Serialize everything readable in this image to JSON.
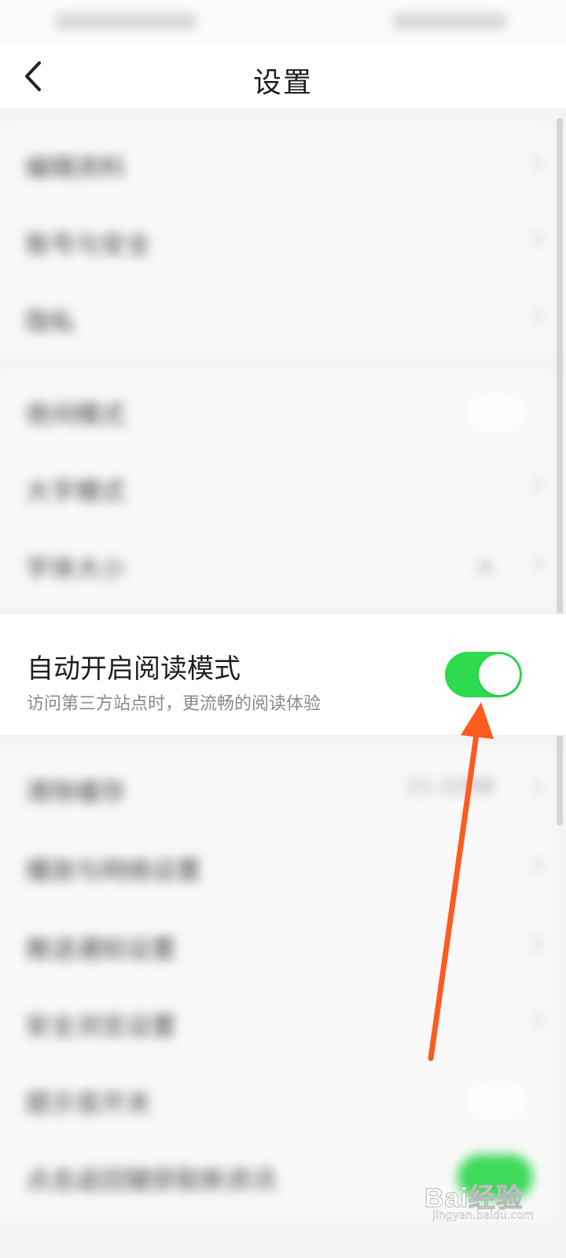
{
  "status_bar": {
    "left_text": "",
    "right_text": ""
  },
  "header": {
    "title": "设置"
  },
  "sections": [
    {
      "items": [
        {
          "label": "编辑资料"
        },
        {
          "label": "账号与安全"
        },
        {
          "label": "隐私"
        }
      ]
    },
    {
      "items": [
        {
          "label": "夜间模式",
          "toggle": "off"
        },
        {
          "label": "大字模式"
        },
        {
          "label": "字体大小",
          "value": "大"
        }
      ]
    },
    {
      "items": [
        {
          "label": "清除缓存",
          "value": "15.32MB"
        },
        {
          "label": "播放与网络设置"
        },
        {
          "label": "推送通知设置"
        },
        {
          "label": "安全浏览设置"
        },
        {
          "label": "提示音开关",
          "toggle": "off"
        },
        {
          "label": "点击返回键获取新资讯",
          "toggle": "on"
        }
      ]
    }
  ],
  "reader_mode": {
    "title": "自动开启阅读模式",
    "subtitle": "访问第三方站点时，更流畅的阅读体验",
    "toggle_state": "on",
    "toggle_color": "#2edb4f"
  },
  "annotation": {
    "arrow_color": "#ff5a1f"
  },
  "watermark": {
    "logo_text": "Bai经验",
    "url_text": "jingyan.baidu.com"
  },
  "icons": [
    "chevron-left-icon",
    "chevron-right-icon"
  ]
}
